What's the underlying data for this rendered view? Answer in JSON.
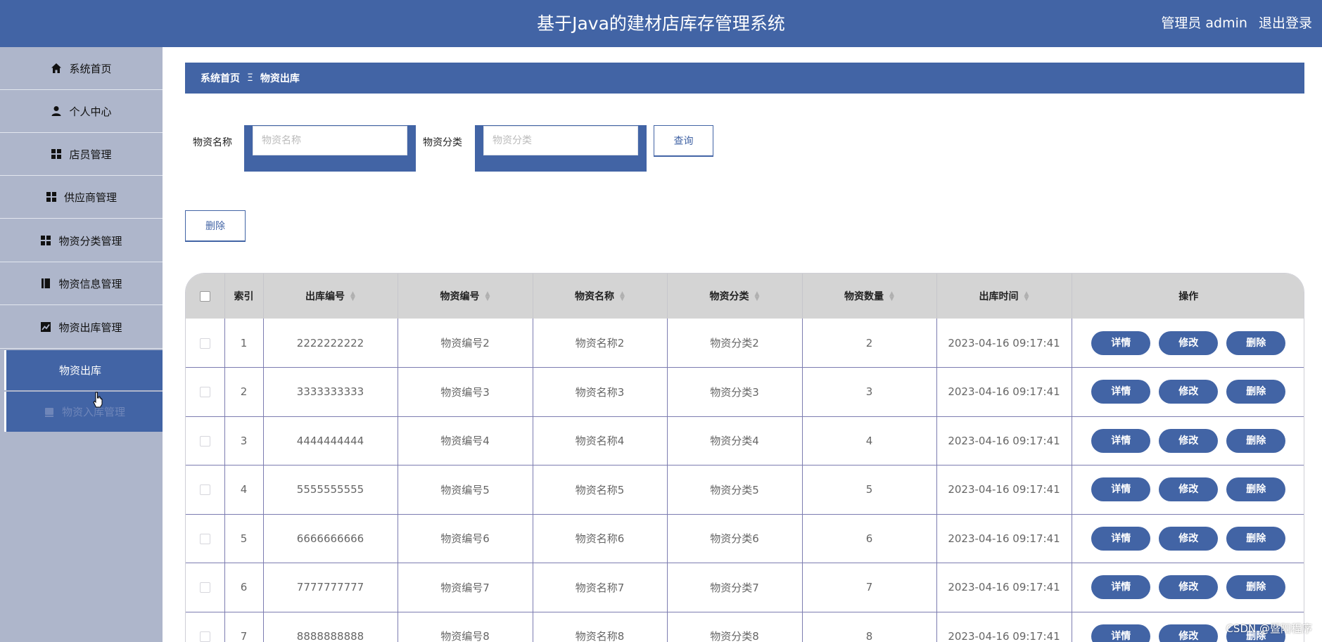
{
  "header": {
    "title": "基于Java的建材店库存管理系统",
    "user_label": "管理员 admin",
    "logout_label": "退出登录"
  },
  "sidebar": {
    "items": [
      {
        "label": "系统首页",
        "icon": "home-icon"
      },
      {
        "label": "个人中心",
        "icon": "user-icon"
      },
      {
        "label": "店员管理",
        "icon": "grid-icon"
      },
      {
        "label": "供应商管理",
        "icon": "grid-icon"
      },
      {
        "label": "物资分类管理",
        "icon": "grid-icon"
      },
      {
        "label": "物资信息管理",
        "icon": "book-icon"
      },
      {
        "label": "物资出库管理",
        "icon": "chart-icon"
      }
    ],
    "sub_items": [
      {
        "label": "物资出库",
        "active": true
      },
      {
        "label": "物资入库管理",
        "active": false
      }
    ]
  },
  "breadcrumb": {
    "home": "系统首页",
    "separator": "Ξ",
    "current": "物资出库"
  },
  "search": {
    "name_label": "物资名称",
    "name_placeholder": "物资名称",
    "name_value": "",
    "category_label": "物资分类",
    "category_placeholder": "物资分类",
    "category_value": "",
    "query_button": "查询"
  },
  "actions": {
    "delete_button": "删除"
  },
  "table": {
    "columns": [
      "索引",
      "出库编号",
      "物资编号",
      "物资名称",
      "物资分类",
      "物资数量",
      "出库时间",
      "操作"
    ],
    "rows": [
      [
        "1",
        "2222222222",
        "物资编号2",
        "物资名称2",
        "物资分类2",
        "2",
        "2023-04-16 09:17:41"
      ],
      [
        "2",
        "3333333333",
        "物资编号3",
        "物资名称3",
        "物资分类3",
        "3",
        "2023-04-16 09:17:41"
      ],
      [
        "3",
        "4444444444",
        "物资编号4",
        "物资名称4",
        "物资分类4",
        "4",
        "2023-04-16 09:17:41"
      ],
      [
        "4",
        "5555555555",
        "物资编号5",
        "物资名称5",
        "物资分类5",
        "5",
        "2023-04-16 09:17:41"
      ],
      [
        "5",
        "6666666666",
        "物资编号6",
        "物资名称6",
        "物资分类6",
        "6",
        "2023-04-16 09:17:41"
      ],
      [
        "6",
        "7777777777",
        "物资编号7",
        "物资名称7",
        "物资分类7",
        "7",
        "2023-04-16 09:17:41"
      ],
      [
        "7",
        "8888888888",
        "物资编号8",
        "物资名称8",
        "物资分类8",
        "8",
        "2023-04-16 09:17:41"
      ]
    ],
    "row_actions": {
      "detail": "详情",
      "edit": "修改",
      "delete": "删除"
    }
  },
  "watermark": "CSDN @暨阳程序",
  "colors": {
    "primary": "#4264a5",
    "sidebar": "#aeb6cb",
    "table_header": "#d4d4d4"
  }
}
